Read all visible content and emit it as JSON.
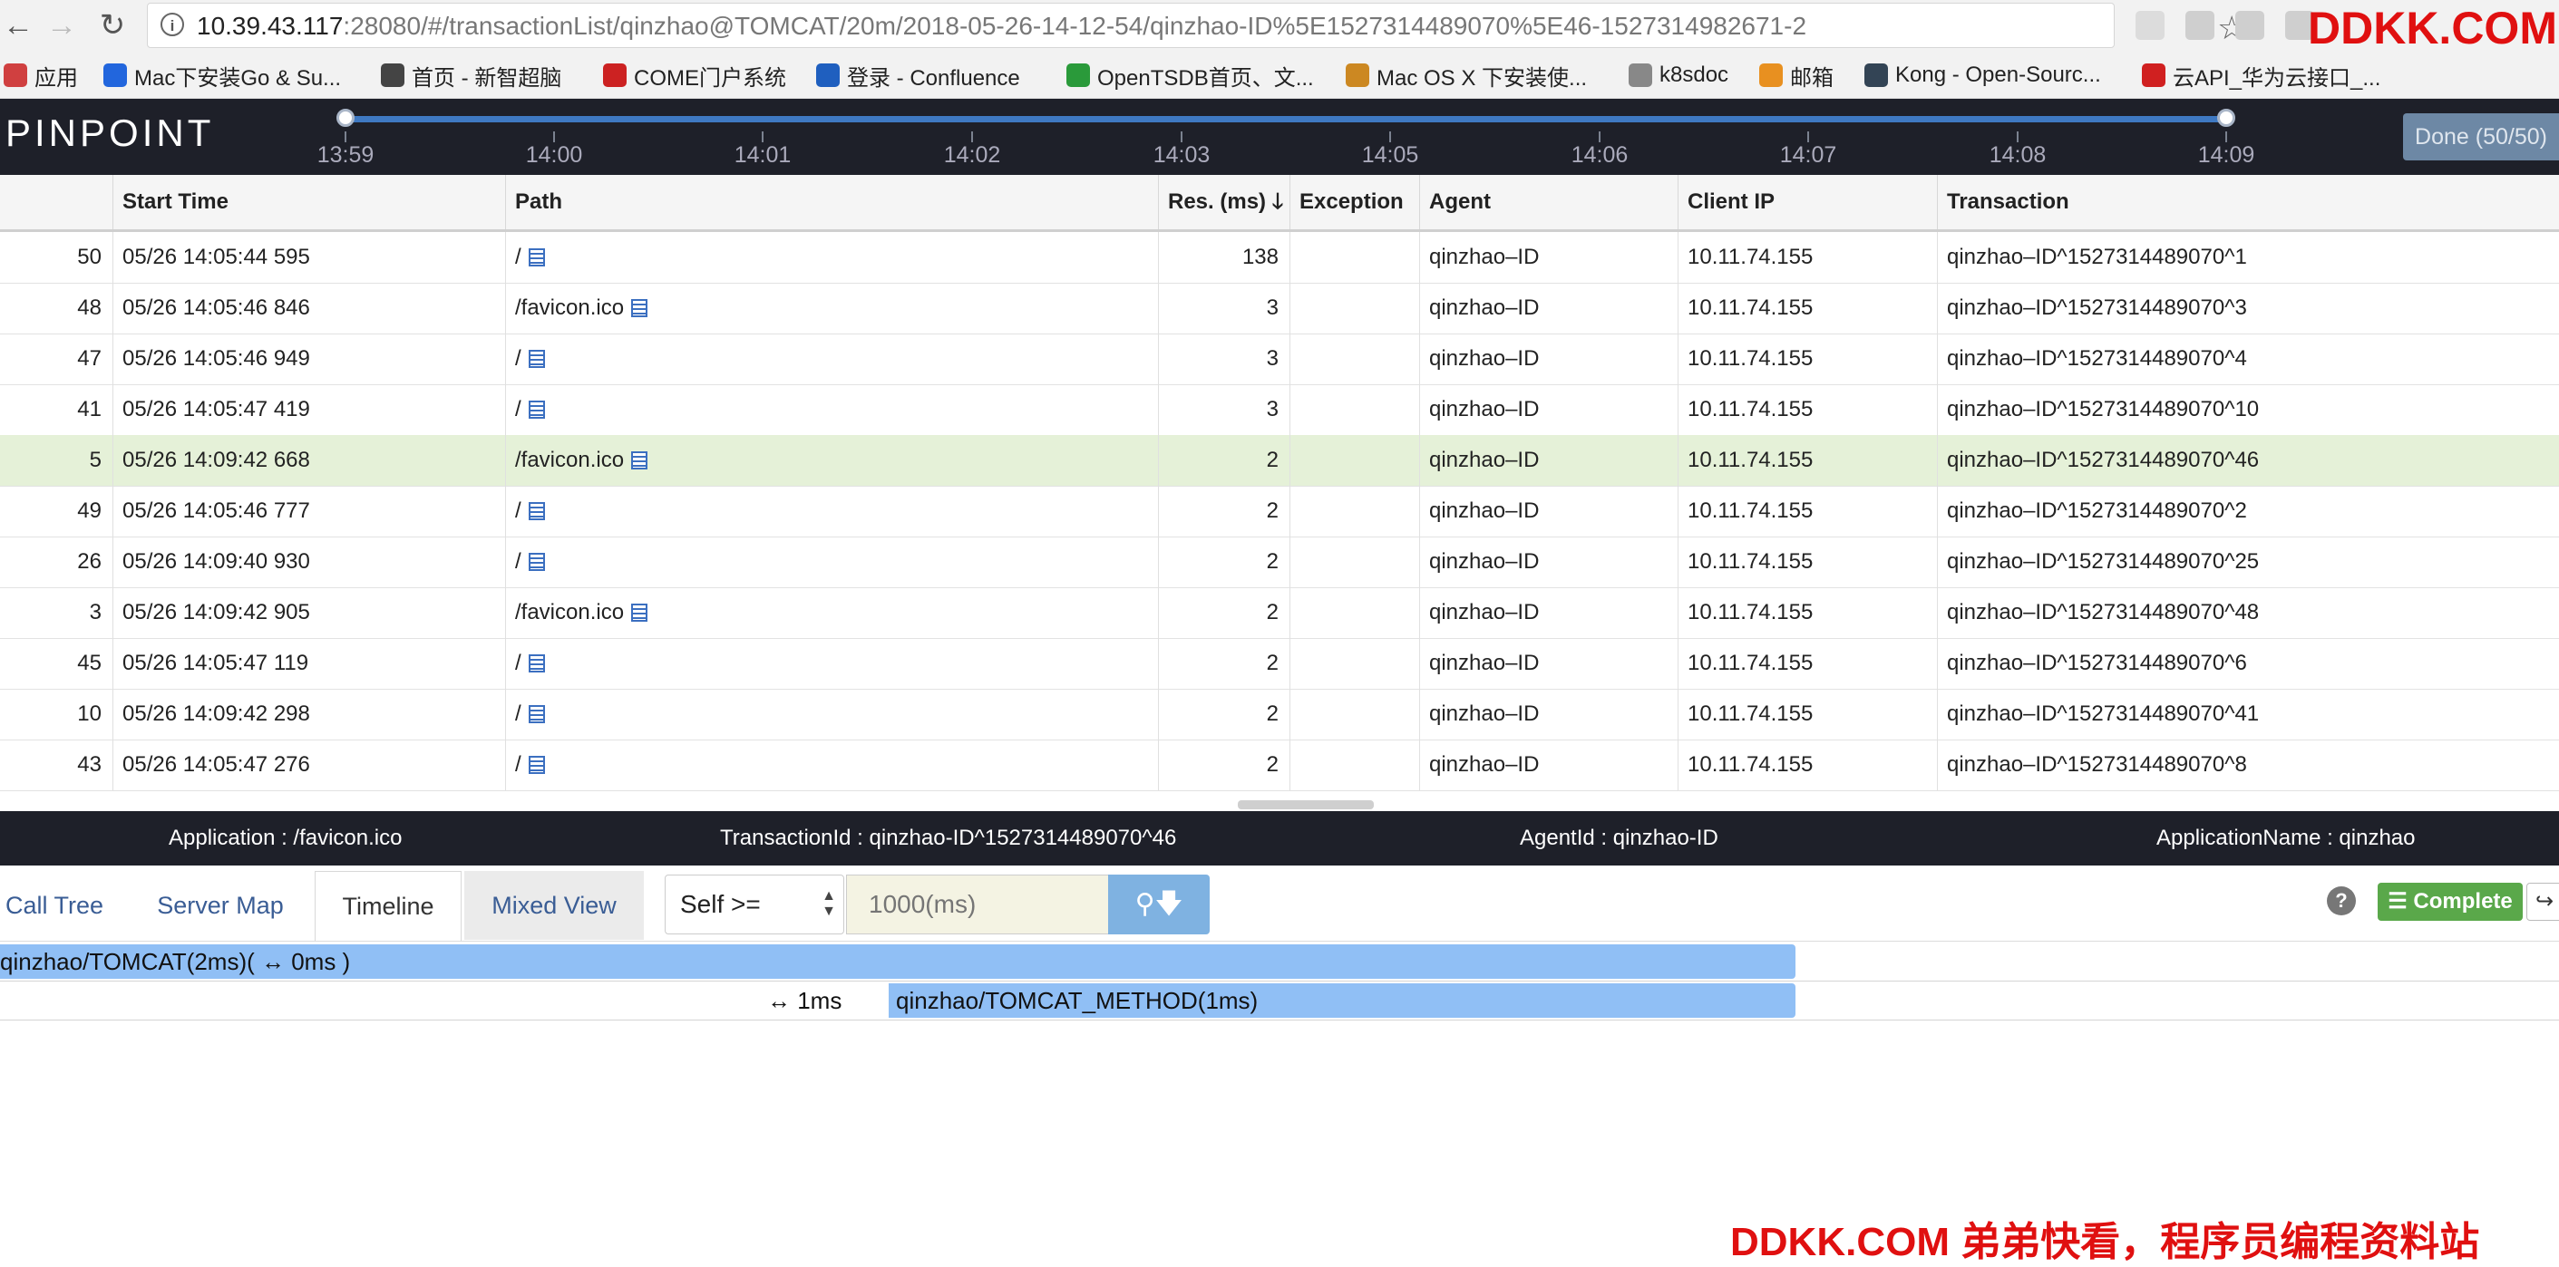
{
  "browser": {
    "url_host": "10.39.43.117",
    "url_rest": ":28080/#/transactionList/qinzhao@TOMCAT/20m/2018-05-26-14-12-54/qinzhao-ID%5E1527314489070%5E46-1527314982671-2",
    "watermark_top": "DDKK.COM",
    "bookmarks": [
      {
        "label": "应用",
        "icon": "apps-grid-icon",
        "color": "#d04040"
      },
      {
        "label": "Mac下安装Go & Su...",
        "icon": "site-c-icon",
        "color": "#2266dd"
      },
      {
        "label": "首页 - 新智超脑",
        "icon": "edit-pen-icon",
        "color": "#444444"
      },
      {
        "label": "COME门户系统",
        "icon": "come-logo-icon",
        "color": "#cc2222"
      },
      {
        "label": "登录 - Confluence",
        "icon": "confluence-x-icon",
        "color": "#1f5fbf"
      },
      {
        "label": "OpenTSDB首页、文...",
        "icon": "green-c-icon",
        "color": "#2a9a3a"
      },
      {
        "label": "Mac OS X 下安装使...",
        "icon": "notepad-icon",
        "color": "#cc8822"
      },
      {
        "label": "k8sdoc",
        "icon": "document-icon",
        "color": "#888888"
      },
      {
        "label": "邮箱",
        "icon": "mail-icon",
        "color": "#e89020"
      },
      {
        "label": "Kong - Open-Sourc...",
        "icon": "kong-gorilla-icon",
        "color": "#334455"
      },
      {
        "label": "云API_华为云接口_...",
        "icon": "huawei-icon",
        "color": "#d02020"
      }
    ]
  },
  "header": {
    "logo": "PINPOINT",
    "ticks": [
      "13:59",
      "14:00",
      "14:01",
      "14:02",
      "14:03",
      "14:05",
      "14:06",
      "14:07",
      "14:08",
      "14:09"
    ],
    "done_label": "Done (50/50)"
  },
  "table": {
    "columns": [
      "Start Time",
      "Path",
      "Res. (ms)",
      "Exception",
      "Agent",
      "Client IP",
      "Transaction"
    ],
    "sort_icon": "sort-desc-arrow-icon",
    "rows": [
      {
        "n": "50",
        "start": "05/26 14:05:44 595",
        "path": "/",
        "res": "138",
        "exception": "",
        "agent": "qinzhao–ID",
        "ip": "10.11.74.155",
        "tx": "qinzhao–ID^1527314489070^1",
        "selected": false
      },
      {
        "n": "48",
        "start": "05/26 14:05:46 846",
        "path": "/favicon.ico",
        "res": "3",
        "exception": "",
        "agent": "qinzhao–ID",
        "ip": "10.11.74.155",
        "tx": "qinzhao–ID^1527314489070^3",
        "selected": false
      },
      {
        "n": "47",
        "start": "05/26 14:05:46 949",
        "path": "/",
        "res": "3",
        "exception": "",
        "agent": "qinzhao–ID",
        "ip": "10.11.74.155",
        "tx": "qinzhao–ID^1527314489070^4",
        "selected": false
      },
      {
        "n": "41",
        "start": "05/26 14:05:47 419",
        "path": "/",
        "res": "3",
        "exception": "",
        "agent": "qinzhao–ID",
        "ip": "10.11.74.155",
        "tx": "qinzhao–ID^1527314489070^10",
        "selected": false
      },
      {
        "n": "5",
        "start": "05/26 14:09:42 668",
        "path": "/favicon.ico",
        "res": "2",
        "exception": "",
        "agent": "qinzhao–ID",
        "ip": "10.11.74.155",
        "tx": "qinzhao–ID^1527314489070^46",
        "selected": true
      },
      {
        "n": "49",
        "start": "05/26 14:05:46 777",
        "path": "/",
        "res": "2",
        "exception": "",
        "agent": "qinzhao–ID",
        "ip": "10.11.74.155",
        "tx": "qinzhao–ID^1527314489070^2",
        "selected": false
      },
      {
        "n": "26",
        "start": "05/26 14:09:40 930",
        "path": "/",
        "res": "2",
        "exception": "",
        "agent": "qinzhao–ID",
        "ip": "10.11.74.155",
        "tx": "qinzhao–ID^1527314489070^25",
        "selected": false
      },
      {
        "n": "3",
        "start": "05/26 14:09:42 905",
        "path": "/favicon.ico",
        "res": "2",
        "exception": "",
        "agent": "qinzhao–ID",
        "ip": "10.11.74.155",
        "tx": "qinzhao–ID^1527314489070^48",
        "selected": false
      },
      {
        "n": "45",
        "start": "05/26 14:05:47 119",
        "path": "/",
        "res": "2",
        "exception": "",
        "agent": "qinzhao–ID",
        "ip": "10.11.74.155",
        "tx": "qinzhao–ID^1527314489070^6",
        "selected": false
      },
      {
        "n": "10",
        "start": "05/26 14:09:42 298",
        "path": "/",
        "res": "2",
        "exception": "",
        "agent": "qinzhao–ID",
        "ip": "10.11.74.155",
        "tx": "qinzhao–ID^1527314489070^41",
        "selected": false
      },
      {
        "n": "43",
        "start": "05/26 14:05:47 276",
        "path": "/",
        "res": "2",
        "exception": "",
        "agent": "qinzhao–ID",
        "ip": "10.11.74.155",
        "tx": "qinzhao–ID^1527314489070^8",
        "selected": false
      }
    ]
  },
  "info_bar": {
    "application": "Application : /favicon.ico",
    "transaction_id": "TransactionId : qinzhao-ID^1527314489070^46",
    "agent_id": "AgentId : qinzhao-ID",
    "application_name": "ApplicationName : qinzhao"
  },
  "tabs": {
    "call_tree": "Call Tree",
    "server_map": "Server Map",
    "timeline": "Timeline",
    "mixed_view": "Mixed View",
    "active": "Timeline"
  },
  "filter": {
    "select_value": "Self >=",
    "input_placeholder": "1000(ms)",
    "complete_label": "Complete"
  },
  "timeline": {
    "rows": [
      {
        "label": "qinzhao/TOMCAT(2ms)( ↔ 0ms )",
        "gap": ""
      },
      {
        "label": "qinzhao/TOMCAT_METHOD(1ms)",
        "gap": "↔ 1ms"
      }
    ]
  },
  "watermark_bottom": "DDKK.COM 弟弟快看，程序员编程资料站",
  "colors": {
    "header_bg": "#1e2029",
    "selected_row": "#e5f1d8",
    "timeline_bar": "#90bff5",
    "complete_green": "#5aa84a",
    "watermark_red": "#e01010"
  }
}
